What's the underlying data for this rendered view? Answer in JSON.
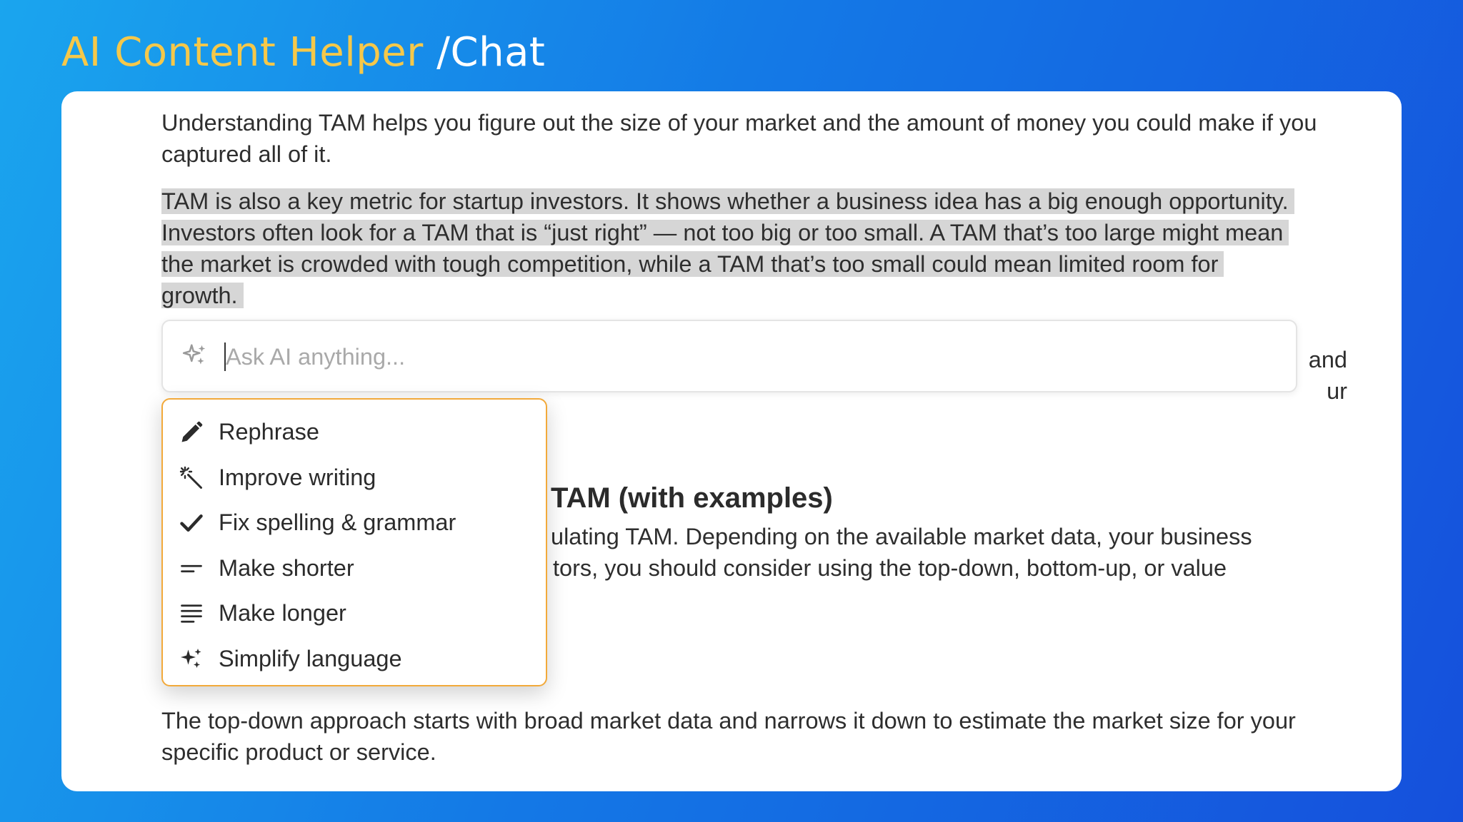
{
  "header": {
    "app_name": "AI Content Helper",
    "section": "/Chat"
  },
  "document": {
    "p1": "Understanding TAM helps you figure out the size of your market and the amount of money you could make if you captured all of it.",
    "p2_selected": "TAM is also a key metric for startup investors. It shows whether a business idea has a big enough opportunity. Investors often look for a TAM that is “just right” — not too big or too small. A TAM that’s too large might mean the market is crowded with tough competition, while a TAM that’s too small could mean limited room for growth.",
    "p3_line1": "and",
    "p3_line2": "ur",
    "heading": "TAM (with examples)",
    "p4_line1": "ulating TAM. Depending on the available market data, your business",
    "p4_line2": "tors, you should consider using the top-down, bottom-up, or value",
    "p5": "The top-down approach starts with broad market data and narrows it down to estimate the market size for your specific product or service."
  },
  "ai_prompt": {
    "icon": "sparkles-icon",
    "placeholder": "Ask AI anything..."
  },
  "menu": {
    "items": [
      {
        "label": "Rephrase",
        "icon": "pencil-icon"
      },
      {
        "label": "Improve writing",
        "icon": "magic-wand-icon"
      },
      {
        "label": "Fix spelling & grammar",
        "icon": "checkmark-icon"
      },
      {
        "label": "Make shorter",
        "icon": "short-lines-icon"
      },
      {
        "label": "Make longer",
        "icon": "long-lines-icon"
      },
      {
        "label": "Simplify language",
        "icon": "sparkles-icon"
      }
    ],
    "border_color": "#f2a93a"
  },
  "colors": {
    "brand": "#f5c84a",
    "selection": "#d6d6d6"
  }
}
